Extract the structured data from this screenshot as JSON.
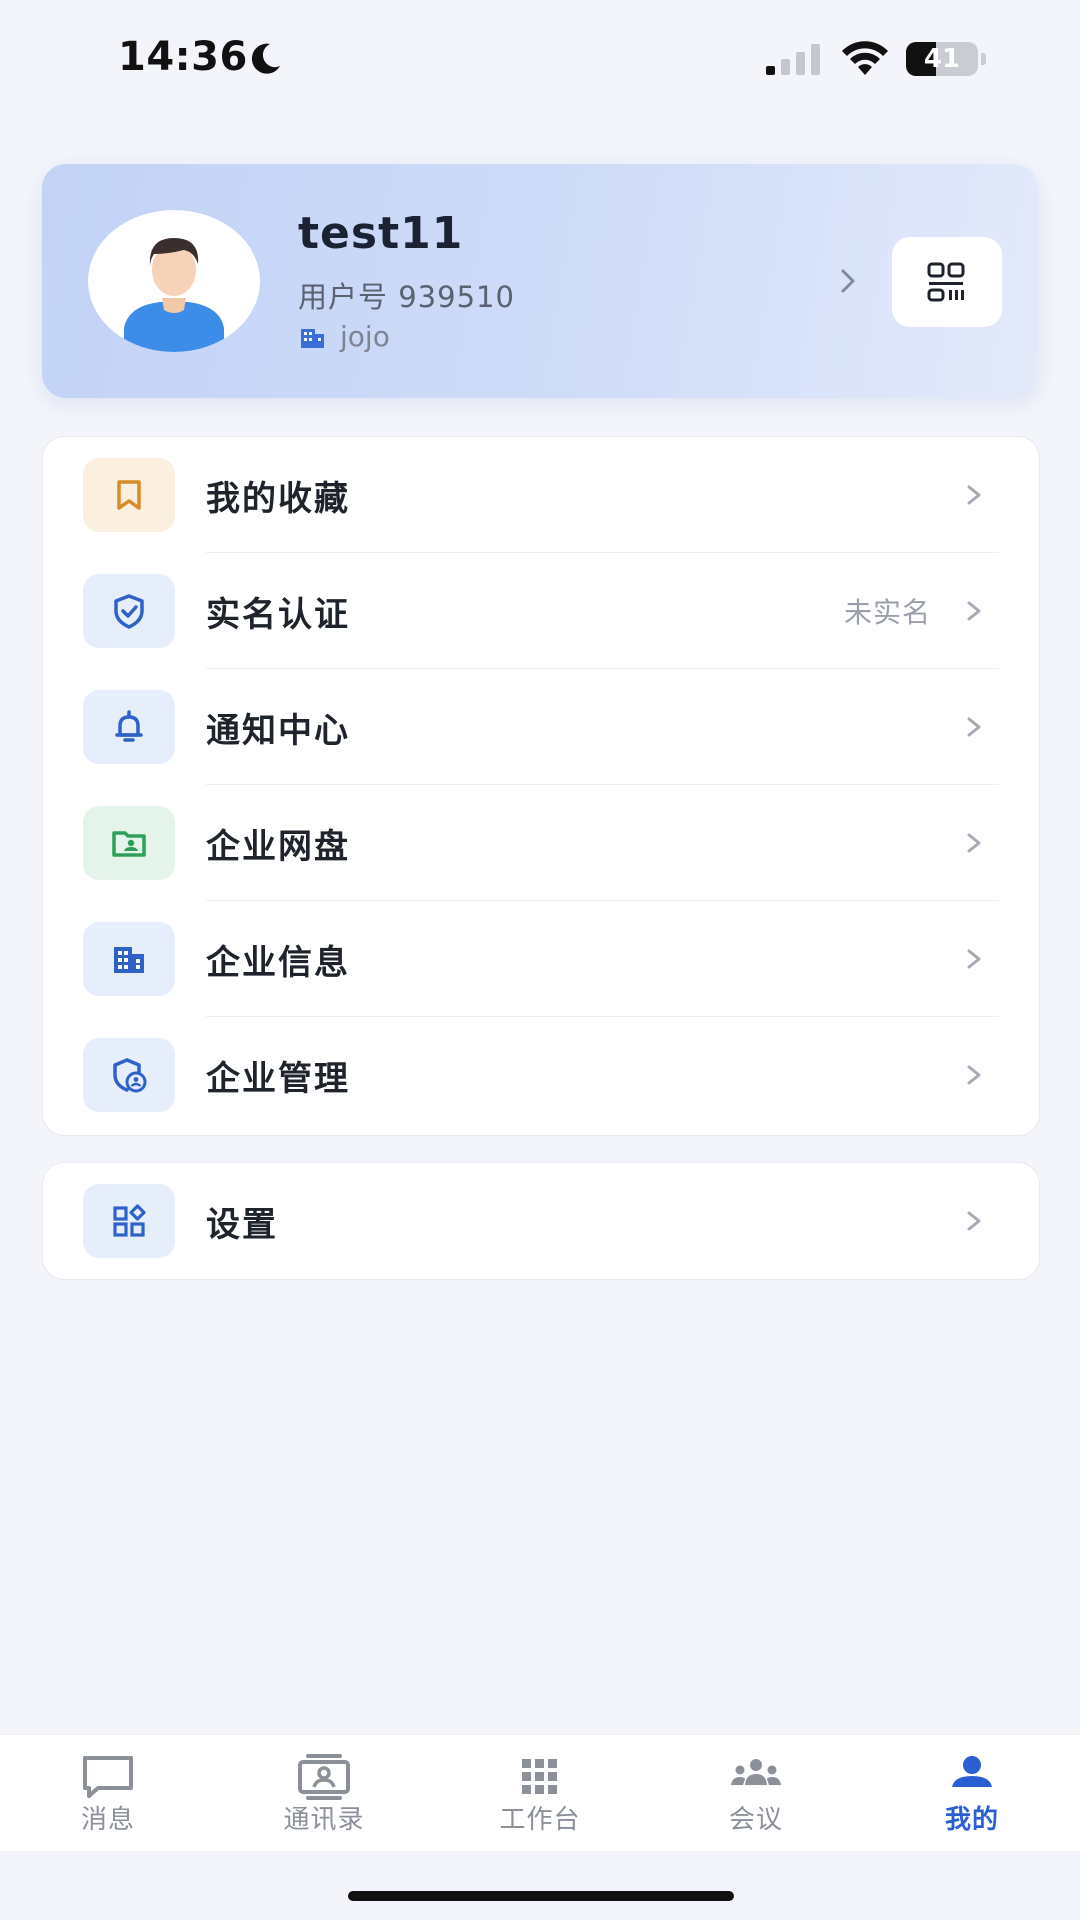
{
  "status_bar": {
    "time": "14:36",
    "battery": "41",
    "battery_level": 0.41
  },
  "profile": {
    "name": "test11",
    "user_id": "用户号 939510",
    "org": "jojo"
  },
  "menu": {
    "items": [
      {
        "label": "我的收藏",
        "value": "",
        "icon": "bookmark-icon",
        "icon_color": "#d98a2b",
        "icon_bg": "#fbefdf"
      },
      {
        "label": "实名认证",
        "value": "未实名",
        "icon": "shield-check-icon",
        "icon_color": "#2f62c9",
        "icon_bg": "#e6edfb"
      },
      {
        "label": "通知中心",
        "value": "",
        "icon": "bell-icon",
        "icon_color": "#2f62c9",
        "icon_bg": "#e6edfb"
      },
      {
        "label": "企业网盘",
        "value": "",
        "icon": "folder-user-icon",
        "icon_color": "#2f9e5a",
        "icon_bg": "#e4f4ea"
      },
      {
        "label": "企业信息",
        "value": "",
        "icon": "building-icon",
        "icon_color": "#2f62c9",
        "icon_bg": "#e6edfb"
      },
      {
        "label": "企业管理",
        "value": "",
        "icon": "shield-user-icon",
        "icon_color": "#2f62c9",
        "icon_bg": "#e6edfb"
      }
    ],
    "settings": {
      "label": "设置",
      "icon": "grid-settings-icon",
      "icon_color": "#2f62c9",
      "icon_bg": "#e6edfb"
    }
  },
  "tabbar": {
    "tabs": [
      {
        "label": "消息",
        "icon": "chat-icon",
        "active": false
      },
      {
        "label": "通讯录",
        "icon": "contacts-icon",
        "active": false
      },
      {
        "label": "工作台",
        "icon": "apps-grid-icon",
        "active": false
      },
      {
        "label": "会议",
        "icon": "meeting-icon",
        "active": false
      },
      {
        "label": "我的",
        "icon": "person-icon",
        "active": true
      }
    ],
    "colors": {
      "active": "#2a5fd3",
      "inactive": "#8b9099"
    }
  }
}
